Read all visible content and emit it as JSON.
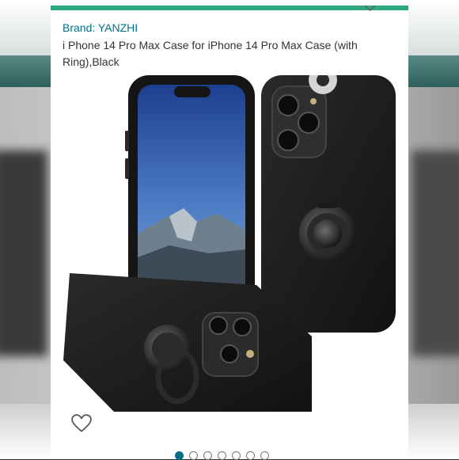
{
  "product": {
    "brand": "Brand: YANZHI",
    "title": "i Phone 14 Pro Max Case for iPhone 14 Pro Max Case (with Ring),Black",
    "image_alt": "Black phone case with ring holder",
    "favorite_icon": "heart-icon"
  },
  "gallery": {
    "total_images": 7,
    "active_index": 0
  },
  "colors": {
    "brand_link": "#007185",
    "accent_bar": "#2fa97b"
  }
}
